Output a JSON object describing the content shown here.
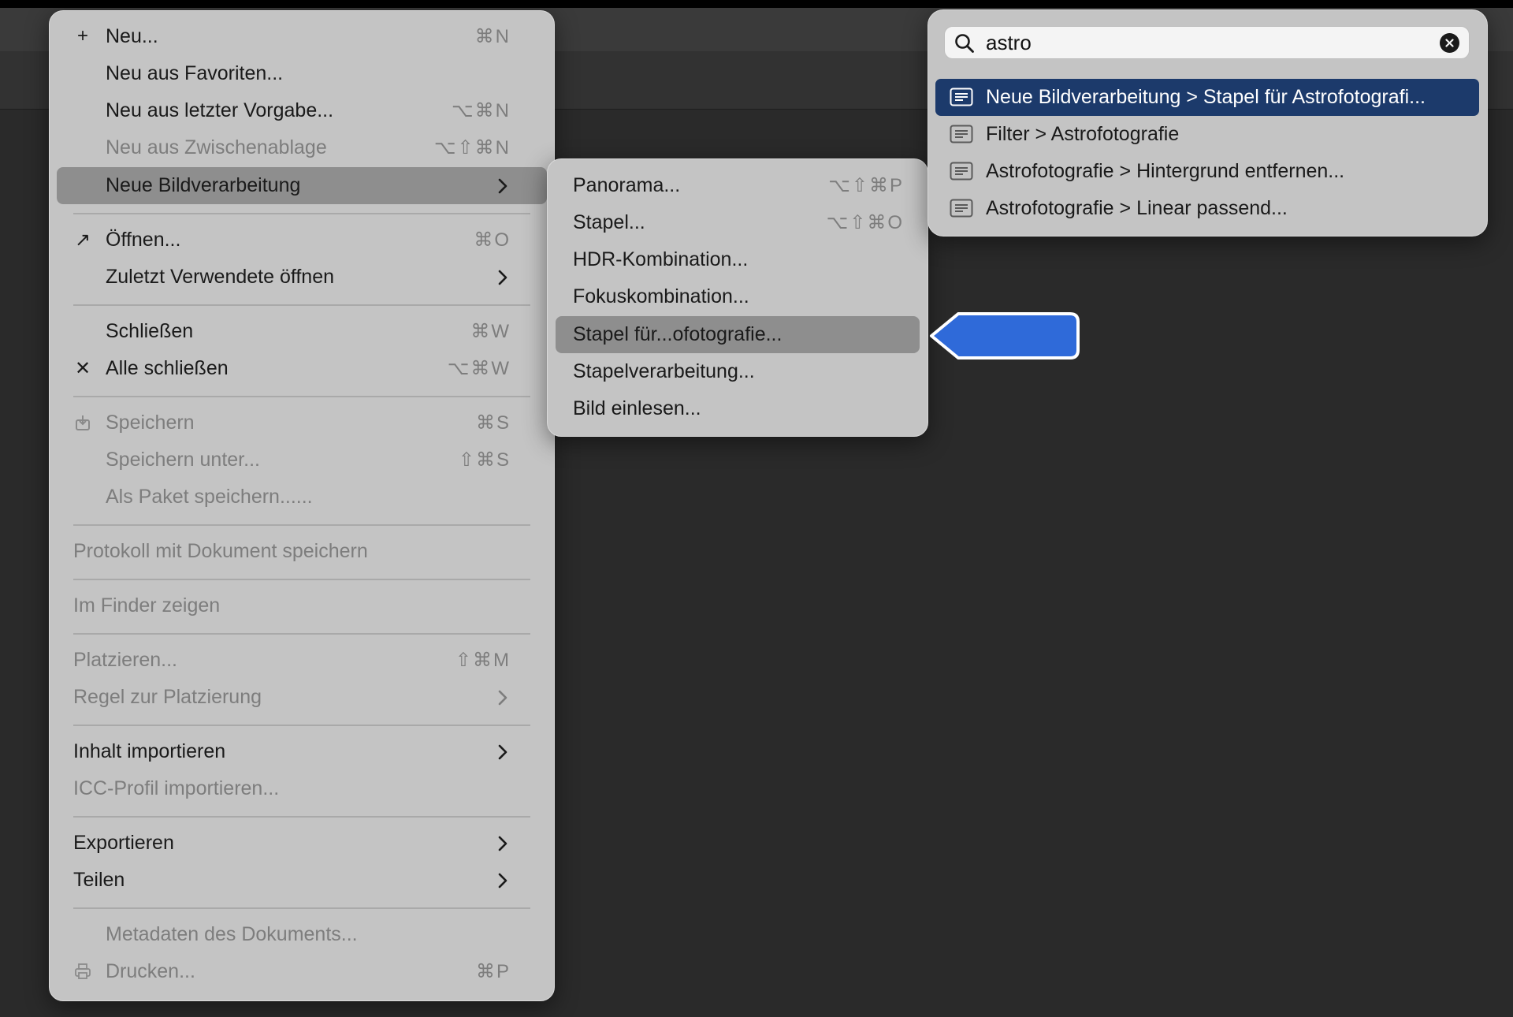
{
  "file_menu": {
    "items": [
      {
        "icon": "plus-icon",
        "glyph": "+",
        "label": "Neu...",
        "shortcut": "⌘N",
        "disabled": false
      },
      {
        "label": "Neu aus Favoriten...",
        "disabled": false
      },
      {
        "label": "Neu aus letzter Vorgabe...",
        "shortcut": "⌥⌘N",
        "disabled": false
      },
      {
        "label": "Neu aus Zwischenablage",
        "shortcut": "⌥⇧⌘N",
        "disabled": true
      },
      {
        "label": "Neue Bildverarbeitung",
        "submenu": true,
        "highlighted": true
      },
      {
        "icon": "arrow-up-right-icon",
        "glyph": "↗",
        "label": "Öffnen...",
        "shortcut": "⌘O"
      },
      {
        "label": "Zuletzt Verwendete öffnen",
        "submenu": true
      },
      {
        "label": "Schließen",
        "shortcut": "⌘W"
      },
      {
        "icon": "close-icon",
        "glyph": "✕",
        "label": "Alle schließen",
        "shortcut": "⌥⌘W"
      },
      {
        "icon": "save-icon",
        "label": "Speichern",
        "shortcut": "⌘S",
        "disabled": true
      },
      {
        "label": "Speichern unter...",
        "shortcut": "⇧⌘S",
        "disabled": true
      },
      {
        "label": "Als Paket speichern......",
        "disabled": true
      },
      {
        "label": "Protokoll mit Dokument speichern",
        "disabled": true
      },
      {
        "label": "Im Finder zeigen",
        "disabled": true
      },
      {
        "label": "Platzieren...",
        "shortcut": "⇧⌘M",
        "disabled": true
      },
      {
        "label": "Regel zur Platzierung",
        "submenu": true,
        "disabled": true
      },
      {
        "label": "Inhalt importieren",
        "submenu": true
      },
      {
        "label": "ICC-Profil importieren...",
        "disabled": true
      },
      {
        "label": "Exportieren",
        "submenu": true
      },
      {
        "label": "Teilen",
        "submenu": true
      },
      {
        "label": "Metadaten des Dokuments...",
        "disabled": true
      },
      {
        "icon": "printer-icon",
        "label": "Drucken...",
        "shortcut": "⌘P",
        "disabled": true
      }
    ]
  },
  "submenu": {
    "items": [
      {
        "label": "Panorama...",
        "shortcut": "⌥⇧⌘P"
      },
      {
        "label": "Stapel...",
        "shortcut": "⌥⇧⌘O"
      },
      {
        "label": "HDR-Kombination..."
      },
      {
        "label": "Fokuskombination..."
      },
      {
        "label": "Stapel für...ofotografie...",
        "highlighted": true
      },
      {
        "label": "Stapelverarbeitung..."
      },
      {
        "label": "Bild einlesen..."
      }
    ]
  },
  "search": {
    "query": "astro",
    "icon": "search-icon",
    "clear_icon": "clear-icon",
    "results": [
      {
        "label": "Neue Bildverarbeitung > Stapel für Astrofotografi...",
        "selected": true
      },
      {
        "label": "Filter > Astrofotografie"
      },
      {
        "label": "Astrofotografie > Hintergrund entfernen..."
      },
      {
        "label": "Astrofotografie > Linear passend..."
      }
    ]
  },
  "colors": {
    "menu_bg": "#c4c4c4",
    "menu_highlight": "#8e8e8e",
    "search_selected": "#1c3a6b",
    "pointer_arrow": "#2f6ad9",
    "background": "#2a2a2a"
  }
}
